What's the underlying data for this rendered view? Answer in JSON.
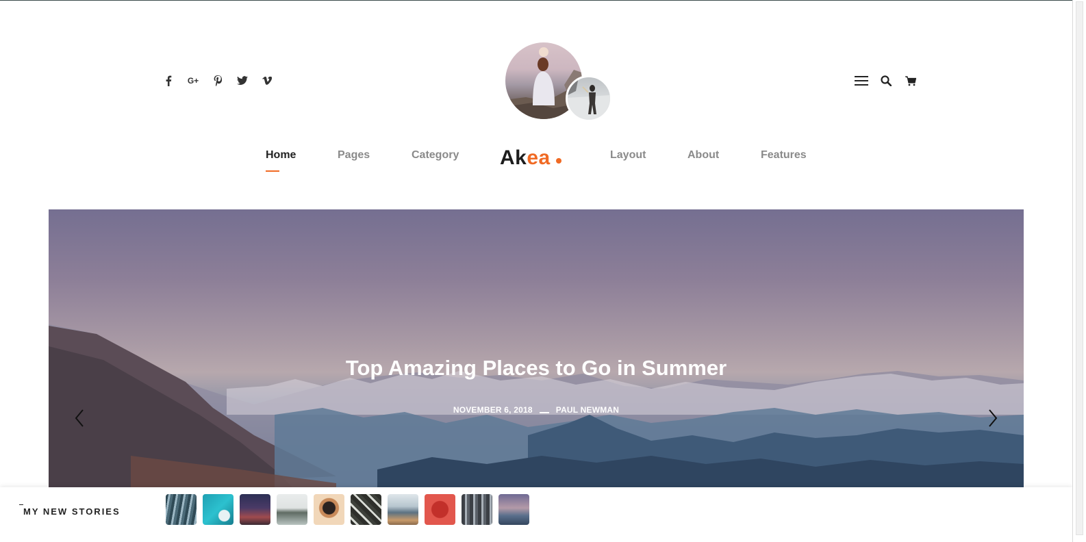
{
  "social": {
    "icons": [
      "facebook-icon",
      "google-plus-icon",
      "pinterest-icon",
      "twitter-icon",
      "vimeo-icon"
    ],
    "google_plus_glyph": "G+"
  },
  "tools": {
    "icons": [
      "hamburger-menu-icon",
      "search-icon",
      "cart-icon"
    ]
  },
  "nav": {
    "items": [
      {
        "label": "Home",
        "active": true
      },
      {
        "label": "Pages",
        "active": false
      },
      {
        "label": "Category",
        "active": false
      },
      {
        "label": "Layout",
        "active": false
      },
      {
        "label": "About",
        "active": false
      },
      {
        "label": "Features",
        "active": false
      }
    ]
  },
  "brand": {
    "part1": "Ak",
    "part2": "ea"
  },
  "hero": {
    "title": "Top Amazing Places to Go in Summer",
    "date": "NOVEMBER 6, 2018",
    "author": "PAUL NEWMAN",
    "prev_icon": "chevron-left-icon",
    "next_icon": "chevron-right-icon"
  },
  "stories": {
    "label": "MY NEW STORIES",
    "thumbnail_count": 10
  },
  "colors": {
    "accent": "#f06a24",
    "text_dark": "#222222",
    "nav_muted": "#8a8a8a"
  }
}
